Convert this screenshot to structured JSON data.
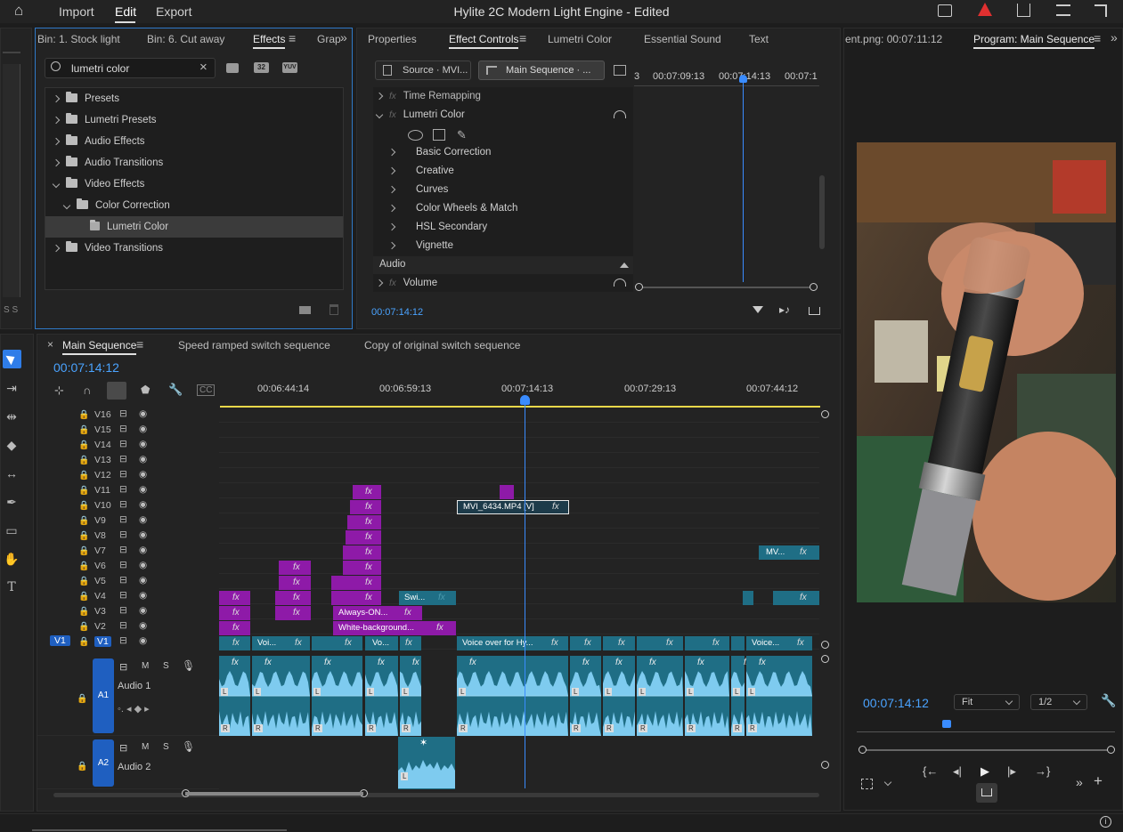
{
  "topbar": {
    "home": "⌂",
    "import": "Import",
    "edit": "Edit",
    "export": "Export",
    "title": "Hylite 2C Modern Light Engine",
    "edited": "- Edited",
    "warn_color": "#e03030"
  },
  "effects_panel": {
    "tabs": [
      "Bin: 1. Stock light",
      "Bin: 6. Cut away",
      "Effects",
      "Grap"
    ],
    "search_value": "lumetri color",
    "tree": [
      {
        "label": "Presets",
        "indent": 0,
        "open": false
      },
      {
        "label": "Lumetri Presets",
        "indent": 0,
        "open": false
      },
      {
        "label": "Audio Effects",
        "indent": 0,
        "open": false
      },
      {
        "label": "Audio Transitions",
        "indent": 0,
        "open": false
      },
      {
        "label": "Video Effects",
        "indent": 0,
        "open": true
      },
      {
        "label": "Color Correction",
        "indent": 1,
        "open": true
      },
      {
        "label": "Lumetri Color",
        "indent": 2,
        "open": false
      },
      {
        "label": "Video Transitions",
        "indent": 0,
        "open": false
      }
    ]
  },
  "effect_controls": {
    "tabs": [
      "Properties",
      "Effect Controls",
      "Lumetri Color",
      "Essential Sound",
      "Text"
    ],
    "source_btn": "Source · MVI...",
    "seq_btn": "Main Sequence · ...",
    "time_labels": [
      "3",
      "00:07:09:13",
      "00:07:14:13",
      "00:07:1"
    ],
    "rows": [
      "Time Remapping",
      "Lumetri Color"
    ],
    "sub_rows": [
      "Basic Correction",
      "Creative",
      "Curves",
      "Color Wheels & Match",
      "HSL Secondary",
      "Vignette"
    ],
    "audio_label": "Audio",
    "volume_label": "Volume",
    "timecode": "00:07:14:12"
  },
  "program": {
    "left_tab": "ent.png: 00:07:11:12",
    "tab": "Program: Main Sequence",
    "timecode": "00:07:14:12",
    "fit": "Fit",
    "res": "1/2"
  },
  "timeline": {
    "tabs": [
      "Main Sequence",
      "Speed ramped switch sequence",
      "Copy of original switch sequence"
    ],
    "timecode": "00:07:14:12",
    "ruler": [
      "00:06:44:14",
      "00:06:59:13",
      "00:07:14:13",
      "00:07:29:13",
      "00:07:44:12"
    ],
    "video_tracks": [
      "V16",
      "V15",
      "V14",
      "V13",
      "V12",
      "V11",
      "V10",
      "V9",
      "V8",
      "V7",
      "V6",
      "V5",
      "V4",
      "V3",
      "V2",
      "V1"
    ],
    "clip_labels": {
      "mvi": "MVI_6434.MP4 [V]",
      "mv": "MV...",
      "swi": "Swi...",
      "always": "Always-ON...",
      "white": "White-background...",
      "voi": "Voi...",
      "vo": "Vo...",
      "voiceover": "Voice over for Hy...",
      "voice": "Voice..."
    },
    "fx": "fx",
    "a1": "A1",
    "a1_name": "Audio 1",
    "a2": "A2",
    "a2_name": "Audio 2",
    "m": "M",
    "s": "S",
    "v1_src": "V1",
    "l": "L",
    "r": "R"
  }
}
